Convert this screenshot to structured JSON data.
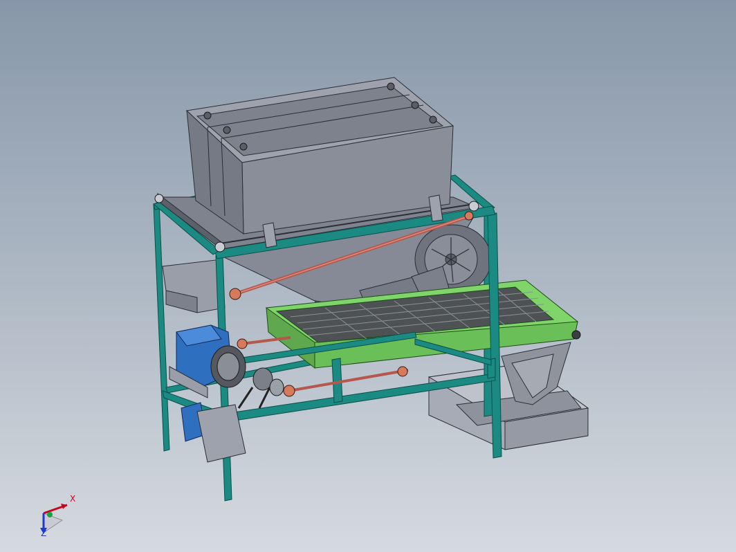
{
  "viewport": {
    "background_top": "#8797a9",
    "background_bottom": "#d5dadf"
  },
  "model": {
    "frame_color": "#1a8a82",
    "frame_edge": "#0b4f4a",
    "hopper_color": "#7a7f8e",
    "sieve_color": "#7fd46a",
    "motor_color": "#2f6fc0",
    "connecting_rod_color": "#b5574b"
  },
  "triad": {
    "x_label": "X",
    "z_label": "Z",
    "x_color": "#d0021b",
    "y_color": "#19a33a",
    "z_color": "#1f3bd1"
  }
}
